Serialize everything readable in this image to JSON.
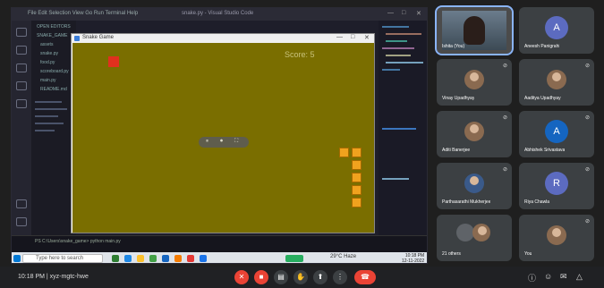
{
  "shared_screen": {
    "vscode_menu": "File  Edit  Selection  View  Go  Run  Terminal  Help",
    "vscode_window_title": "snake.py - Visual Studio Code",
    "explorer_items": [
      "OPEN EDITORS",
      "SNAKE_GAME",
      "assets",
      "snake.py",
      "food.py",
      "scoreboard.py",
      "main.py",
      "README.md"
    ],
    "terminal_line": "PS C:\\Users\\snake_game> python main.py"
  },
  "game_window": {
    "title": "Snake Game",
    "score_label": "Score: 5",
    "pill_labels": [
      "⏸",
      "⏺",
      "⛶"
    ]
  },
  "taskbar": {
    "search_placeholder": "Type here to search",
    "weather": "29°C Haze",
    "time": "10:18 PM",
    "date": "12-11-2022"
  },
  "participants": [
    {
      "name": "Ishita (You)",
      "type": "camera"
    },
    {
      "name": "Aneesh Panigrahi",
      "type": "avatar",
      "letter": "A",
      "color": "#5c6bc0"
    },
    {
      "name": "Vinay Upadhyay",
      "type": "photo"
    },
    {
      "name": "Aaditya Upadhyay",
      "type": "photo"
    },
    {
      "name": "Aditi Banerjee",
      "type": "photo"
    },
    {
      "name": "Abhishek Srivastava",
      "type": "avatar",
      "letter": "A",
      "color": "#1565c0"
    },
    {
      "name": "Parthasarathi Mukherjee",
      "type": "photo"
    },
    {
      "name": "Riya Chawla",
      "type": "avatar",
      "letter": "R",
      "color": "#5c6bc0"
    },
    {
      "name": "21 others",
      "type": "group"
    },
    {
      "name": "You",
      "type": "photo"
    }
  ],
  "meeting": {
    "time_label": "10:18 PM  |  xyz-mgtc-hwe",
    "controls": [
      "mic-off",
      "camera-off",
      "captions",
      "hand",
      "present",
      "more"
    ],
    "right_icons": [
      "info",
      "people",
      "chat",
      "activities"
    ]
  }
}
